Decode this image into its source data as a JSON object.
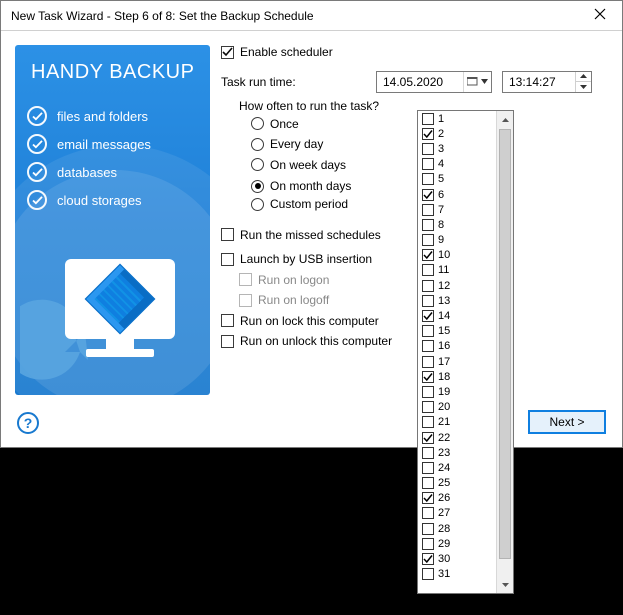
{
  "window": {
    "title": "New Task Wizard - Step 6 of 8: Set the Backup Schedule"
  },
  "promo": {
    "heading": "HANDY BACKUP",
    "features": [
      "files and folders",
      "email messages",
      "databases",
      "cloud storages"
    ]
  },
  "scheduler": {
    "enable_label": "Enable scheduler",
    "enable_checked": true,
    "runtime_label": "Task run time:",
    "date_value": "14.05.2020",
    "time_value": "13:14:27",
    "howoften_label": "How often to run the task?",
    "options": {
      "once": "Once",
      "every_day": "Every day",
      "on_week_days": "On week days",
      "on_month_days": "On month days",
      "custom_period": "Custom period"
    },
    "selected_option": "on_month_days"
  },
  "misc": {
    "run_missed_label": "Run the missed schedules",
    "run_missed_checked": false,
    "launch_usb_label": "Launch by USB insertion",
    "launch_usb_checked": false,
    "run_on_logon": "Run on logon",
    "run_on_logoff": "Run on logoff",
    "run_on_lock": "Run on lock this computer",
    "run_on_lock_checked": false,
    "run_on_unlock": "Run on unlock this computer",
    "run_on_unlock_checked": false
  },
  "days": {
    "labels": [
      "1",
      "2",
      "3",
      "4",
      "5",
      "6",
      "7",
      "8",
      "9",
      "10",
      "11",
      "12",
      "13",
      "14",
      "15",
      "16",
      "17",
      "18",
      "19",
      "20",
      "21",
      "22",
      "23",
      "24",
      "25",
      "26",
      "27",
      "28",
      "29",
      "30",
      "31"
    ],
    "checked": [
      false,
      true,
      false,
      false,
      false,
      true,
      false,
      false,
      false,
      true,
      false,
      false,
      false,
      true,
      false,
      false,
      false,
      true,
      false,
      false,
      false,
      true,
      false,
      false,
      false,
      true,
      false,
      false,
      false,
      true,
      false
    ]
  },
  "buttons": {
    "help": "?",
    "next": "Next >"
  }
}
